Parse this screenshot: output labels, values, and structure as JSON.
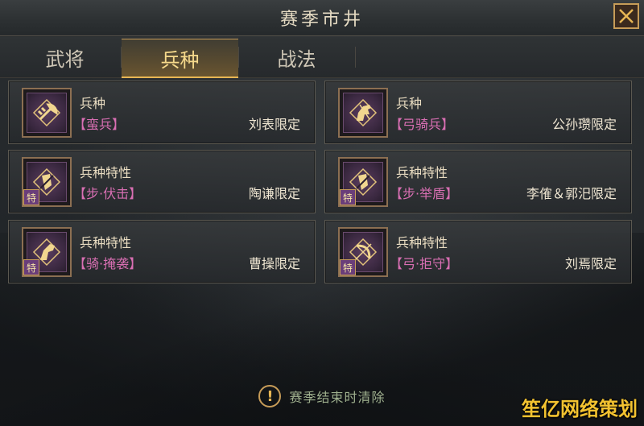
{
  "window": {
    "title": "赛季市井",
    "close_icon": "close-icon"
  },
  "tabs": [
    {
      "label": "武将",
      "active": false
    },
    {
      "label": "兵种",
      "active": true
    },
    {
      "label": "战法",
      "active": false
    }
  ],
  "cards": [
    {
      "type": "兵种",
      "name": "【蛮兵】",
      "limit": "刘表限定",
      "icon": "axe-icon",
      "tag": ""
    },
    {
      "type": "兵种",
      "name": "【弓骑兵】",
      "limit": "公孙瓒限定",
      "icon": "horse-icon",
      "tag": ""
    },
    {
      "type": "兵种特性",
      "name": "【步·伏击】",
      "limit": "陶谦限定",
      "icon": "shield-icon",
      "tag": "特"
    },
    {
      "type": "兵种特性",
      "name": "【步·举盾】",
      "limit": "李傕＆郭汜限定",
      "icon": "shield-icon",
      "tag": "特"
    },
    {
      "type": "兵种特性",
      "name": "【骑·掩袭】",
      "limit": "曹操限定",
      "icon": "horse-head-icon",
      "tag": "特"
    },
    {
      "type": "兵种特性",
      "name": "【弓·拒守】",
      "limit": "刘焉限定",
      "icon": "bow-icon",
      "tag": "特"
    }
  ],
  "notice": {
    "text": "赛季结束时清除",
    "icon": "exclamation-icon"
  },
  "watermark": "笙亿网络策划",
  "colors": {
    "accent_gold": "#e7b654",
    "name_pink": "#d96fb3",
    "notice_green": "#9fb08e"
  }
}
